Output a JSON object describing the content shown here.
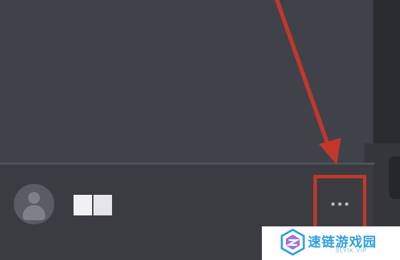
{
  "user_bar": {
    "avatar_icon": "user-avatar-icon",
    "username_redacted": true,
    "more_icon": "more-horizontal-icon"
  },
  "annotation": {
    "arrow_color": "#c2372c",
    "highlight_color": "#c2372c"
  },
  "watermark": {
    "title": "速链游戏园",
    "subtitle": "SLYIK.VIP",
    "accent_color": "#2f9ee0"
  }
}
